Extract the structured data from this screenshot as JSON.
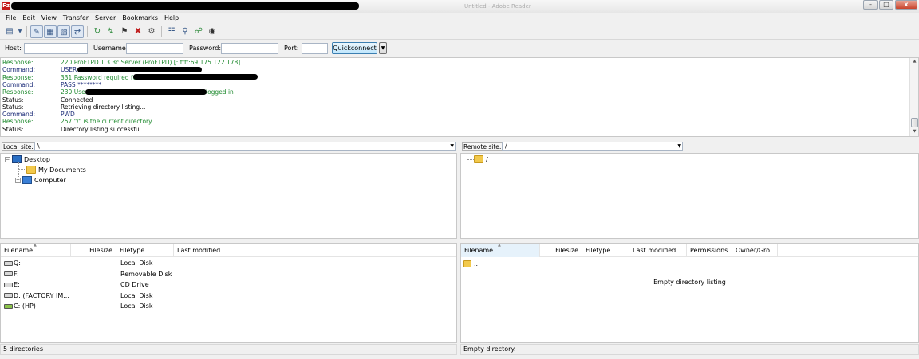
{
  "window": {
    "app_icon": "Fz",
    "background_tab": "Untitled - Adobe Reader",
    "controls": {
      "minimize": "–",
      "maximize": "□",
      "close": "x"
    }
  },
  "menu": [
    "File",
    "Edit",
    "View",
    "Transfer",
    "Server",
    "Bookmarks",
    "Help"
  ],
  "toolbar": {
    "icons": [
      "site-manager-icon",
      "dropdown-icon",
      "toggle-log-icon",
      "toggle-local-tree-icon",
      "toggle-remote-tree-icon",
      "toggle-queue-icon",
      "refresh-icon",
      "process-queue-icon",
      "cancel-icon",
      "disconnect-icon",
      "reconnect-icon",
      "filter-icon",
      "compare-icon",
      "sync-browse-icon",
      "search-icon"
    ]
  },
  "quickconnect": {
    "host_label": "Host:",
    "username_label": "Username:",
    "password_label": "Password:",
    "port_label": "Port:",
    "host_value": "",
    "username_value": "",
    "password_value": "",
    "port_value": "",
    "button_label": "Quickconnect",
    "dropdown_glyph": "▼"
  },
  "log": [
    {
      "type": "Response:",
      "text": "220 ProFTPD 1.3.3c Server (ProFTPD) [::ffff:69.175.122.178]",
      "color": "green"
    },
    {
      "type": "Command:",
      "text": "USER",
      "color": "navy"
    },
    {
      "type": "Response:",
      "text": "331 Password required for",
      "color": "green"
    },
    {
      "type": "Command:",
      "text": "PASS ********",
      "color": "navy"
    },
    {
      "type": "Response:",
      "text": "230 User",
      "suffix": "logged in",
      "color": "green"
    },
    {
      "type": "Status:",
      "text": "Connected",
      "color": "black"
    },
    {
      "type": "Status:",
      "text": "Retrieving directory listing...",
      "color": "black"
    },
    {
      "type": "Command:",
      "text": "PWD",
      "color": "navy"
    },
    {
      "type": "Response:",
      "text": "257 \"/\" is the current directory",
      "color": "green"
    },
    {
      "type": "Status:",
      "text": "Directory listing successful",
      "color": "black"
    }
  ],
  "local": {
    "site_label": "Local site:",
    "path": "\\",
    "tree": {
      "root": "Desktop",
      "children": [
        "My Documents",
        "Computer"
      ]
    },
    "columns": [
      "Filename",
      "Filesize",
      "Filetype",
      "Last modified"
    ],
    "files": [
      {
        "name": "Q:",
        "type": "Local Disk"
      },
      {
        "name": "F:",
        "type": "Removable Disk"
      },
      {
        "name": "E:",
        "type": "CD Drive"
      },
      {
        "name": "D: (FACTORY IM...",
        "type": "Local Disk"
      },
      {
        "name": "C: (HP)",
        "type": "Local Disk"
      }
    ],
    "status": "5 directories"
  },
  "remote": {
    "site_label": "Remote site:",
    "path": "/",
    "tree": {
      "root": "/"
    },
    "columns": [
      "Filename",
      "Filesize",
      "Filetype",
      "Last modified",
      "Permissions",
      "Owner/Gro..."
    ],
    "files": [
      {
        "name": ".."
      }
    ],
    "empty_message": "Empty directory listing",
    "status": "Empty directory."
  },
  "colors": {
    "log_response": "#1e8a2e",
    "log_command": "#1b2b78",
    "quickconnect_button": "#bee6fd",
    "sorted_column": "#e6f2fb"
  }
}
